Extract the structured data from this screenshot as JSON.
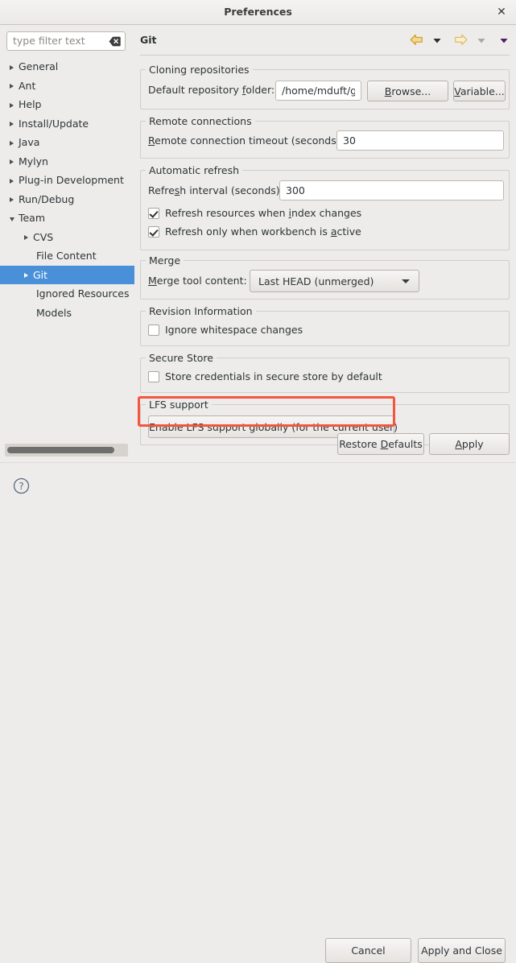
{
  "window": {
    "title": "Preferences",
    "close_label": "✕"
  },
  "sidebar": {
    "filter": {
      "placeholder": "type filter text",
      "value": "",
      "clear_icon": "clear-icon"
    },
    "items": [
      {
        "label": "General",
        "level": 0,
        "expander": "collapsed",
        "selected": false
      },
      {
        "label": "Ant",
        "level": 0,
        "expander": "collapsed",
        "selected": false
      },
      {
        "label": "Help",
        "level": 0,
        "expander": "collapsed",
        "selected": false
      },
      {
        "label": "Install/Update",
        "level": 0,
        "expander": "collapsed",
        "selected": false
      },
      {
        "label": "Java",
        "level": 0,
        "expander": "collapsed",
        "selected": false
      },
      {
        "label": "Mylyn",
        "level": 0,
        "expander": "collapsed",
        "selected": false
      },
      {
        "label": "Plug-in Development",
        "level": 0,
        "expander": "collapsed",
        "selected": false
      },
      {
        "label": "Run/Debug",
        "level": 0,
        "expander": "collapsed",
        "selected": false
      },
      {
        "label": "Team",
        "level": 0,
        "expander": "expanded",
        "selected": false
      },
      {
        "label": "CVS",
        "level": 1,
        "expander": "collapsed",
        "selected": false
      },
      {
        "label": "File Content",
        "level": 1,
        "expander": "none",
        "selected": false
      },
      {
        "label": "Git",
        "level": 1,
        "expander": "collapsed",
        "selected": true
      },
      {
        "label": "Ignored Resources",
        "level": 1,
        "expander": "none",
        "selected": false
      },
      {
        "label": "Models",
        "level": 1,
        "expander": "none",
        "selected": false
      }
    ],
    "scrollbar": "horizontal-scrollbar"
  },
  "page": {
    "title": "Git",
    "nav": {
      "back_icon": "back-arrow-icon",
      "back_menu_icon": "back-dropdown-icon",
      "forward_icon": "forward-arrow-icon",
      "forward_menu_icon": "forward-dropdown-icon",
      "view_menu_icon": "view-menu-dropdown-icon"
    },
    "groups": {
      "cloning": {
        "label": "Cloning repositories",
        "repo_folder_label_pre": "Default repository ",
        "repo_folder_label_mnemonic": "f",
        "repo_folder_label_post": "older:",
        "repo_folder_value": "/home/mduft/git",
        "browse_mnemonic": "B",
        "browse_label_post": "rowse...",
        "variable_mnemonic": "V",
        "variable_label_post": "ariable..."
      },
      "remote": {
        "label": "Remote connections",
        "timeout_label_mnemonic": "R",
        "timeout_label_post": "emote connection timeout (seconds):",
        "timeout_value": "30"
      },
      "refresh": {
        "label": "Automatic refresh",
        "interval_label_pre": "Refre",
        "interval_label_mnemonic": "s",
        "interval_label_post": "h interval (seconds):",
        "interval_value": "300",
        "check_index_pre": "Refresh resources when ",
        "check_index_mnemonic": "i",
        "check_index_post": "ndex changes",
        "check_index_checked": true,
        "check_workbench_pre": "Refresh only when workbench is ",
        "check_workbench_mnemonic": "a",
        "check_workbench_post": "ctive",
        "check_workbench_checked": true
      },
      "merge": {
        "label": "Merge",
        "tool_label_mnemonic": "M",
        "tool_label_post": "erge tool content:",
        "tool_value": "Last HEAD (unmerged)",
        "tool_options": [
          "Last HEAD (unmerged)"
        ]
      },
      "revision": {
        "label": "Revision Information",
        "ignore_ws_label": "Ignore whitespace changes",
        "ignore_ws_checked": false
      },
      "secure_store": {
        "label": "Secure Store",
        "store_creds_label": "Store credentials in secure store by default",
        "store_creds_checked": false
      },
      "lfs": {
        "label": "LFS support",
        "enable_button_label": "Enable LFS support globally (for the current user)",
        "highlight_color": "#f4553d"
      }
    },
    "restore_defaults_pre": "Restore ",
    "restore_defaults_mnemonic": "D",
    "restore_defaults_post": "efaults",
    "apply_mnemonic": "A",
    "apply_post": "pply"
  },
  "footer": {
    "help_icon": "help-icon",
    "cancel_label": "Cancel",
    "apply_close_label": "Apply and Close"
  },
  "colors": {
    "selection_blue": "#4a90d9",
    "background": "#edeceb",
    "annotation_red": "#f4553d"
  }
}
